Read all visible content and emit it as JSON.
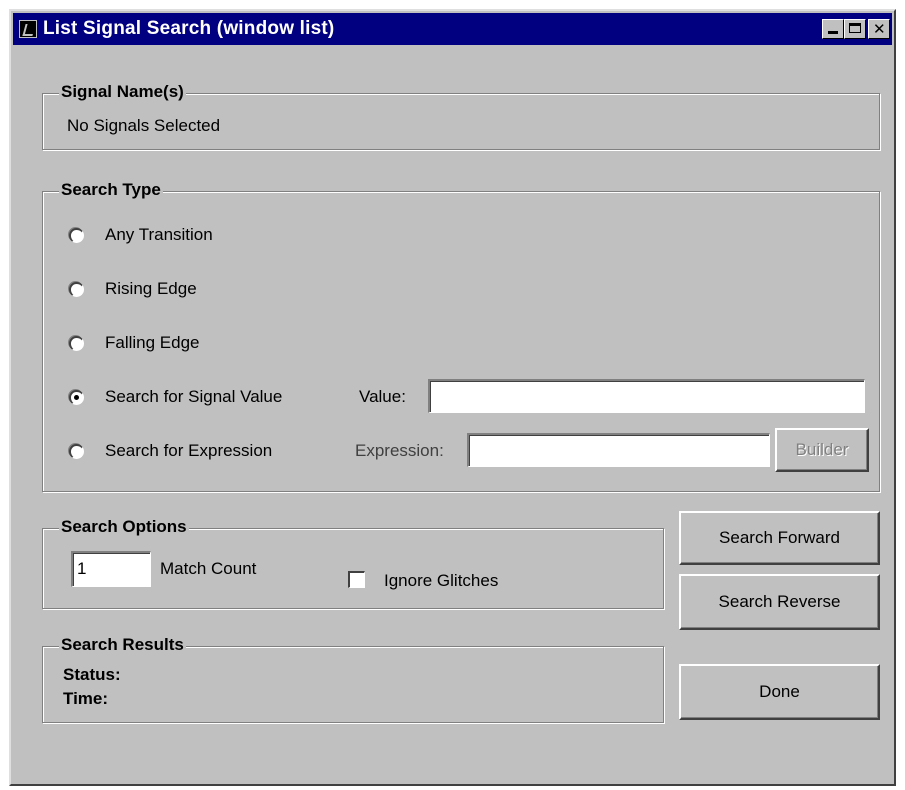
{
  "window": {
    "title": "List Signal Search (window list)"
  },
  "signal_names": {
    "legend": "Signal Name(s)",
    "value": "No Signals Selected"
  },
  "search_type": {
    "legend": "Search Type",
    "options": [
      {
        "label": "Any Transition",
        "checked": false
      },
      {
        "label": "Rising Edge",
        "checked": false
      },
      {
        "label": "Falling Edge",
        "checked": false
      },
      {
        "label": "Search for Signal Value",
        "checked": true
      },
      {
        "label": "Search for Expression",
        "checked": false
      }
    ],
    "value_label": "Value:",
    "value_input": "",
    "expression_label": "Expression:",
    "expression_input": "",
    "builder_label": "Builder"
  },
  "search_options": {
    "legend": "Search Options",
    "match_count_value": "1",
    "match_count_label": "Match Count",
    "ignore_glitches_label": "Ignore Glitches",
    "ignore_glitches_checked": false
  },
  "search_results": {
    "legend": "Search Results",
    "status_label": "Status:",
    "time_label": "Time:"
  },
  "buttons": {
    "search_forward": "Search Forward",
    "search_reverse": "Search Reverse",
    "done": "Done"
  }
}
